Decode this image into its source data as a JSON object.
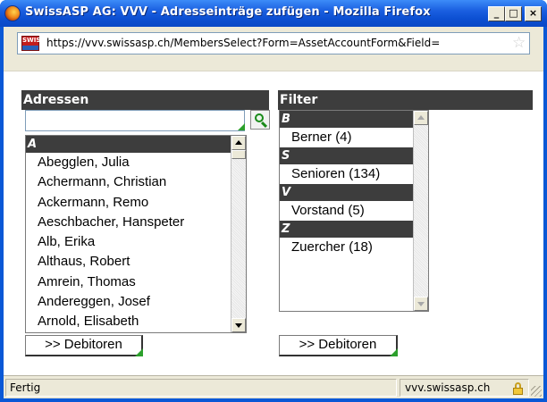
{
  "window": {
    "title": "SwissASP AG: VVV - Adresseinträge zufügen - Mozilla Firefox",
    "controls": {
      "minimize": "_",
      "maximize": "□",
      "close": "×"
    }
  },
  "urlbar": {
    "url": "https://vvv.swissasp.ch/MembersSelect?Form=AssetAccountForm&Field=",
    "site_badge": "SWISS",
    "star": "☆"
  },
  "addresses": {
    "header": "Adressen",
    "search_value": "",
    "groups": [
      {
        "letter": "A",
        "items": [
          "Abegglen, Julia",
          "Achermann, Christian",
          "Ackermann, Remo",
          "Aeschbacher, Hanspeter",
          "Alb, Erika",
          "Althaus, Robert",
          "Amrein, Thomas",
          "Andereggen, Josef",
          "Arnold, Elisabeth"
        ]
      }
    ],
    "button": ">> Debitoren"
  },
  "filter": {
    "header": "Filter",
    "groups": [
      {
        "letter": "B",
        "item": "Berner (4)"
      },
      {
        "letter": "S",
        "item": "Senioren (134)"
      },
      {
        "letter": "V",
        "item": "Vorstand (5)"
      },
      {
        "letter": "Z",
        "item": "Zuercher (18)"
      }
    ],
    "button": ">> Debitoren"
  },
  "statusbar": {
    "status": "Fertig",
    "domain": "vvv.swissasp.ch"
  },
  "colors": {
    "titlebar": "#0c4fd2",
    "header_bg": "#3d3d3d",
    "accent_green": "#2ca02c"
  }
}
